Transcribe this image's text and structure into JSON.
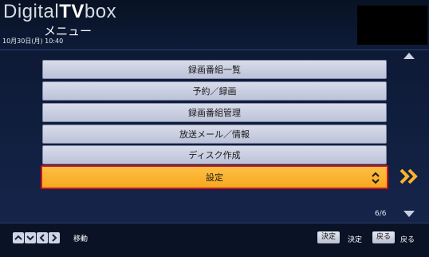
{
  "header": {
    "logo_part1": "Digital",
    "logo_part2": "TV",
    "logo_part3": "box",
    "title": "メニュー",
    "datetime": "10月30日(月) 10:40"
  },
  "menu": {
    "items": [
      {
        "label": "録画番組一覧"
      },
      {
        "label": "予約／録画"
      },
      {
        "label": "録画番組管理"
      },
      {
        "label": "放送メール／情報"
      },
      {
        "label": "ディスク作成"
      },
      {
        "label": "設定",
        "selected": true
      }
    ],
    "page_indicator": "6/6"
  },
  "footer": {
    "nav_label": "移動",
    "ok_key": "決定",
    "ok_label": "決定",
    "back_key": "戻る",
    "back_label": "戻る"
  },
  "colors": {
    "background": "#0c1730",
    "item": "#cfd4e3",
    "selected": "#f9b02a",
    "selected_border": "#cc1420"
  },
  "icons": [
    "up-arrow-icon",
    "down-arrow-icon",
    "left-arrow-icon",
    "right-arrow-icon",
    "updown-icon",
    "double-chevron-right-icon"
  ]
}
